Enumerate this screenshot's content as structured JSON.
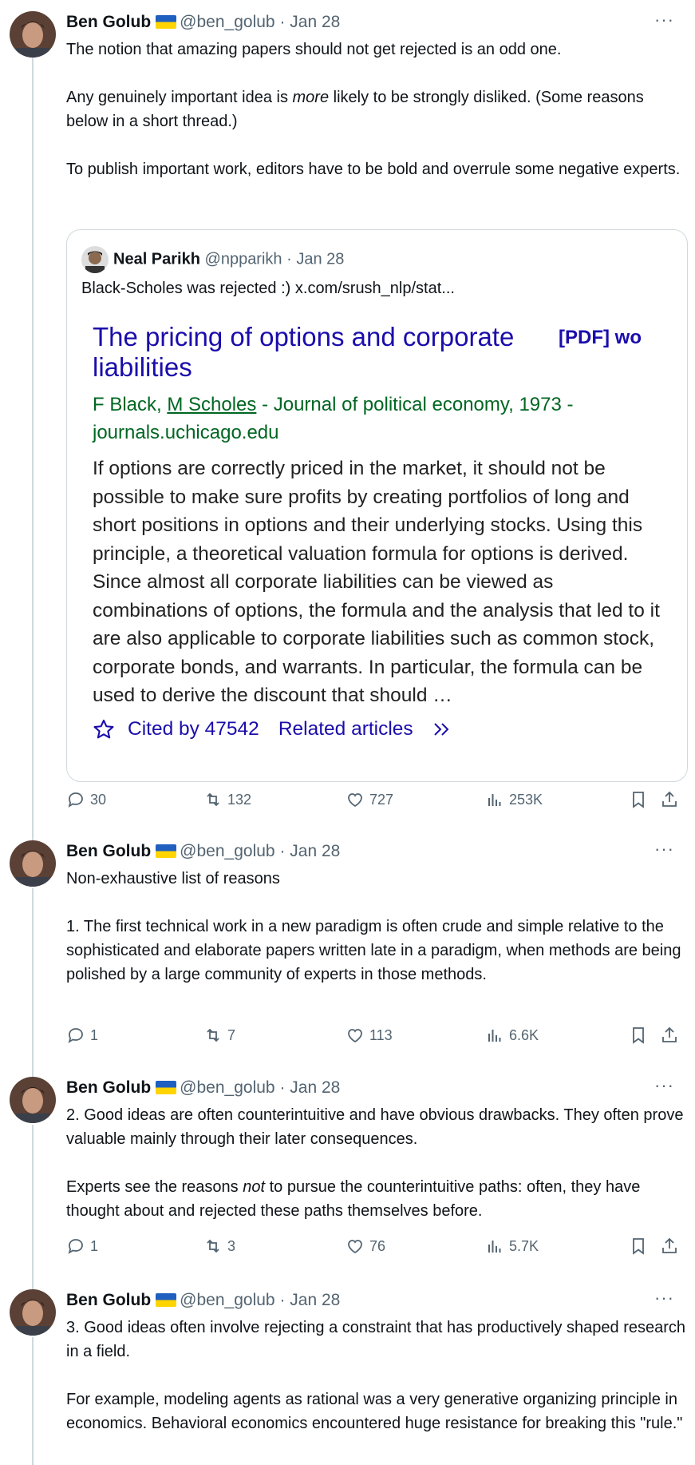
{
  "tweets": [
    {
      "name": "Ben Golub",
      "handle": "@ben_golub",
      "date": "· Jan 28",
      "more": "···",
      "paragraphs": [
        "The notion that amazing papers should not get rejected is an odd one.",
        "Any genuinely important idea is more likely to be strongly disliked. (Some reasons below in a short thread.)",
        "To publish important work, editors have to be bold and overrule some negative experts."
      ],
      "replies": "30",
      "retweets": "132",
      "likes": "727",
      "views": "253K"
    },
    {
      "name": "Ben Golub",
      "handle": "@ben_golub",
      "date": "· Jan 28",
      "more": "···",
      "paragraphs": [
        "Non-exhaustive list of reasons",
        "1. The first technical work in a new paradigm is often crude and simple relative to the sophisticated and elaborate papers written late in a paradigm, when methods are being polished by a large community of experts in those methods."
      ],
      "replies": "1",
      "retweets": "7",
      "likes": "113",
      "views": "6.6K"
    },
    {
      "name": "Ben Golub",
      "handle": "@ben_golub",
      "date": "· Jan 28",
      "more": "···",
      "paragraphs": [
        "2. Good ideas are often counterintuitive and have obvious drawbacks. They often prove valuable mainly through their later consequences.",
        "Experts see the reasons not to pursue the counterintuitive paths: often, they have thought about and rejected these paths themselves before."
      ],
      "replies": "1",
      "retweets": "3",
      "likes": "76",
      "views": "5.7K"
    },
    {
      "name": "Ben Golub",
      "handle": "@ben_golub",
      "date": "· Jan 28",
      "more": "···",
      "paragraphs": [
        "3. Good ideas often involve rejecting a constraint that has productively shaped research in a field.",
        "For example,  modeling agents as rational was a very generative organizing principle in economics. Behavioral economics encountered huge resistance for breaking this \"rule.\""
      ]
    }
  ],
  "quote": {
    "name": "Neal Parikh",
    "handle": "@npparikh",
    "date": "· Jan 28",
    "text": "Black-Scholes was rejected :)  x.com/srush_nlp/stat...",
    "scholar": {
      "title": "The pricing of options and corporate liabilities",
      "pdf": "[PDF] wo",
      "authors_prefix": "F Black, ",
      "authors_link": "M Scholes",
      "authors_suffix": " - Journal of political economy, 1973 - journals.uchicago.edu",
      "abstract": "If options are correctly priced in the market, it should not be possible to make sure profits by creating portfolios of long and short positions in options and their underlying stocks. Using this principle, a theoretical valuation formula for options is derived. Since almost all corporate liabilities can be viewed as combinations of options, the formula and the analysis that led to it are also applicable to corporate liabilities such as common stock, corporate bonds, and warrants. In particular, the formula can be used to derive the discount that should …",
      "cited_by": "Cited by 47542",
      "related": "Related articles"
    }
  },
  "icons": [
    "reply-icon",
    "retweet-icon",
    "like-icon",
    "views-icon",
    "bookmark-icon",
    "share-icon",
    "star-icon",
    "double-chevron-icon"
  ],
  "colors": {
    "text": "#0f1419",
    "secondary": "#536471",
    "border": "#cfd9de",
    "scholar_link": "#1a0dab",
    "scholar_green": "#006621"
  }
}
